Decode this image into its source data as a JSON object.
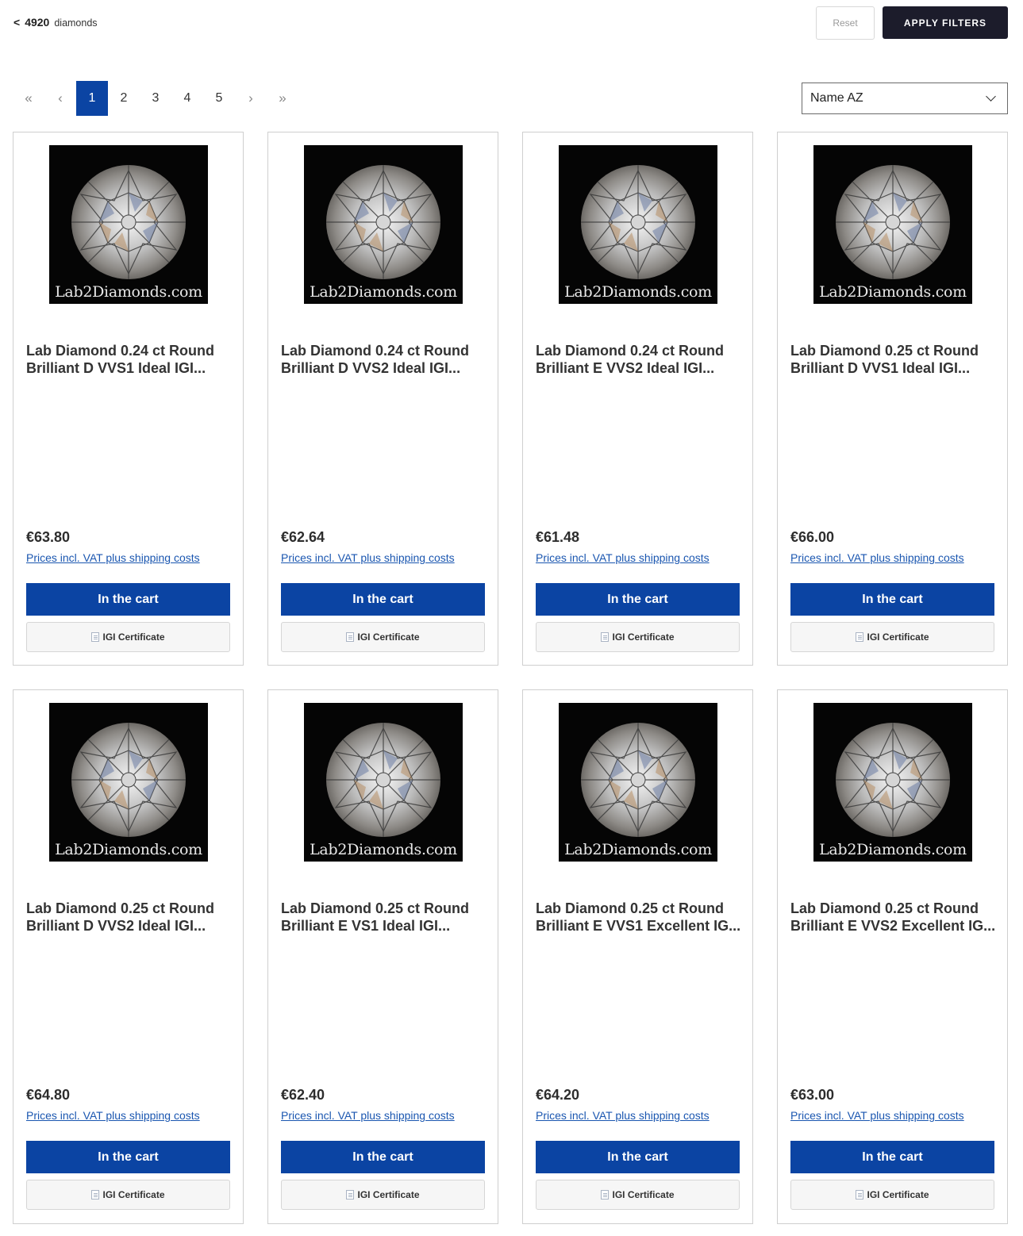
{
  "header": {
    "back_symbol": "<",
    "count": "4920",
    "count_label": "diamonds",
    "reset_label": "Reset",
    "apply_label": "APPLY FILTERS"
  },
  "pagination": {
    "first": "«",
    "prev": "‹",
    "pages": [
      "1",
      "2",
      "3",
      "4",
      "5"
    ],
    "active_page": "1",
    "next": "›",
    "last": "»"
  },
  "sort": {
    "selected": "Name AZ"
  },
  "colors": {
    "primary_blue": "#0b44a3",
    "dark_button": "#1c1c2b",
    "link_blue": "#1a56b0"
  },
  "products": [
    {
      "watermark": "Lab2Diamonds.com",
      "title": "Lab Diamond 0.24 ct Round Brilliant D VVS1 Ideal IGI...",
      "price": "€63.80",
      "vat_note": "Prices incl. VAT plus shipping costs",
      "cart_label": "In the cart",
      "cert_label": "IGI Certificate"
    },
    {
      "watermark": "Lab2Diamonds.com",
      "title": "Lab Diamond 0.24 ct Round Brilliant D VVS2 Ideal IGI...",
      "price": "€62.64",
      "vat_note": "Prices incl. VAT plus shipping costs",
      "cart_label": "In the cart",
      "cert_label": "IGI Certificate"
    },
    {
      "watermark": "Lab2Diamonds.com",
      "title": "Lab Diamond 0.24 ct Round Brilliant E VVS2 Ideal IGI...",
      "price": "€61.48",
      "vat_note": "Prices incl. VAT plus shipping costs",
      "cart_label": "In the cart",
      "cert_label": "IGI Certificate"
    },
    {
      "watermark": "Lab2Diamonds.com",
      "title": "Lab Diamond 0.25 ct Round Brilliant D VVS1 Ideal IGI...",
      "price": "€66.00",
      "vat_note": "Prices incl. VAT plus shipping costs",
      "cart_label": "In the cart",
      "cert_label": "IGI Certificate"
    },
    {
      "watermark": "Lab2Diamonds.com",
      "title": "Lab Diamond 0.25 ct Round Brilliant D VVS2 Ideal IGI...",
      "price": "€64.80",
      "vat_note": "Prices incl. VAT plus shipping costs",
      "cart_label": "In the cart",
      "cert_label": "IGI Certificate"
    },
    {
      "watermark": "Lab2Diamonds.com",
      "title": "Lab Diamond 0.25 ct Round Brilliant E VS1 Ideal IGI...",
      "price": "€62.40",
      "vat_note": "Prices incl. VAT plus shipping costs",
      "cart_label": "In the cart",
      "cert_label": "IGI Certificate"
    },
    {
      "watermark": "Lab2Diamonds.com",
      "title": "Lab Diamond 0.25 ct Round Brilliant E VVS1 Excellent IG...",
      "price": "€64.20",
      "vat_note": "Prices incl. VAT plus shipping costs",
      "cart_label": "In the cart",
      "cert_label": "IGI Certificate"
    },
    {
      "watermark": "Lab2Diamonds.com",
      "title": "Lab Diamond 0.25 ct Round Brilliant E VVS2 Excellent IG...",
      "price": "€63.00",
      "vat_note": "Prices incl. VAT plus shipping costs",
      "cart_label": "In the cart",
      "cert_label": "IGI Certificate"
    }
  ]
}
